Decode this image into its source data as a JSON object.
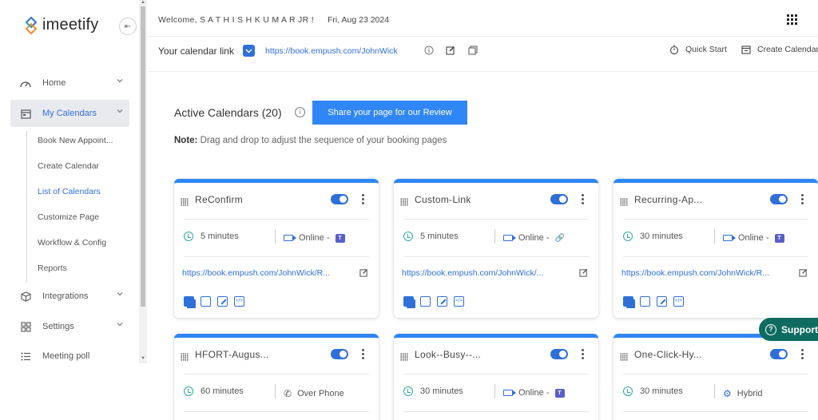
{
  "app": {
    "name": "imeetify"
  },
  "header": {
    "welcome": "Welcome, S A T H I S H K U M A R JR !",
    "date": "Fri, Aug 23 2024"
  },
  "linkbar": {
    "label": "Your calendar link",
    "url": "https://book.empush.com/JohnWick",
    "quick_start": "Quick Start",
    "create_calendar": "Create Calendar"
  },
  "sidebar": {
    "items": [
      {
        "label": "Home"
      },
      {
        "label": "My Calendars"
      },
      {
        "label": "Integrations"
      },
      {
        "label": "Settings"
      },
      {
        "label": "Meeting poll"
      }
    ],
    "sub_items": [
      {
        "label": "Book New Appoint..."
      },
      {
        "label": "Create Calendar"
      },
      {
        "label": "List of Calendars"
      },
      {
        "label": "Customize Page"
      },
      {
        "label": "Workflow & Config"
      },
      {
        "label": "Reports"
      }
    ]
  },
  "main": {
    "active_title": "Active Calendars (20)",
    "share_button": "Share your page for our Review",
    "note_label": "Note:",
    "note_text": " Drag and drop to adjust the sequence of your booking pages"
  },
  "cards": [
    {
      "title": "ReConfirm",
      "duration": "5 minutes",
      "mode": "Online -",
      "mode_icon": "video-icon",
      "extra_icon": "teams-icon",
      "url": "https://book.empush.com/JohnWick/R...",
      "enabled": true
    },
    {
      "title": "Custom-Link",
      "duration": "5 minutes",
      "mode": "Online -",
      "mode_icon": "video-icon",
      "extra_icon": "link-icon",
      "url": "https://book.empush.com/JohnWick/...",
      "enabled": true
    },
    {
      "title": "Recurring-Ap...",
      "duration": "30 minutes",
      "mode": "Online -",
      "mode_icon": "video-icon",
      "extra_icon": "teams-icon",
      "url": "https://book.empush.com/JohnWick/R...",
      "enabled": true
    },
    {
      "title": "HFORT-Augus...",
      "duration": "60 minutes",
      "mode": "Over Phone",
      "mode_icon": "phone-icon",
      "extra_icon": "",
      "url": "",
      "enabled": true
    },
    {
      "title": "Look--Busy--...",
      "duration": "30 minutes",
      "mode": "Online -",
      "mode_icon": "video-icon",
      "extra_icon": "teams-icon",
      "url": "",
      "enabled": true
    },
    {
      "title": "One-Click-Hy...",
      "duration": "30 minutes",
      "mode": "Hybrid",
      "mode_icon": "hybrid-gear-icon",
      "extra_icon": "",
      "url": "",
      "enabled": true
    }
  ],
  "support": {
    "label": "Support"
  },
  "colors": {
    "accent": "#2f6fd8",
    "button": "#2f86f4",
    "duration_icon": "#2ea9a0",
    "support_bg": "#0f6b60"
  }
}
